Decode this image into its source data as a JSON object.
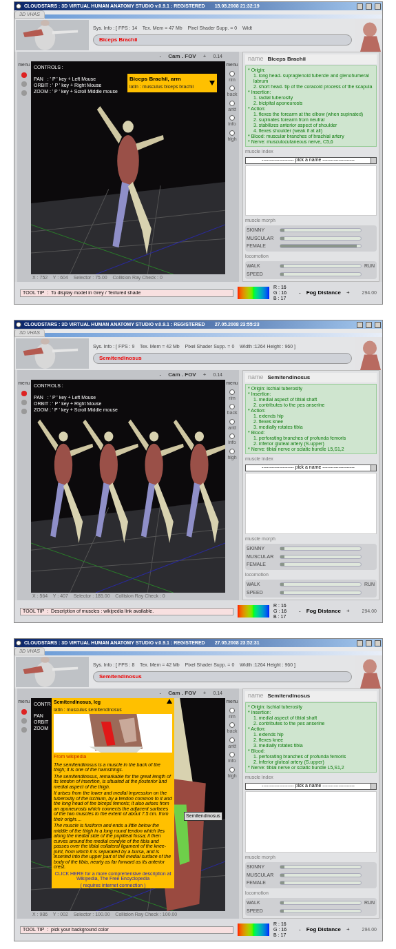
{
  "screens": [
    {
      "title": "CLOUDSTARS : 3D VIRTUAL HUMAN ANATOMY STUDIO v.0.9.1 : REGISTERED",
      "datetime": "15.05.2008 21:32:19",
      "tab": "3D VHAS",
      "sys_info": "Sys. Info : [ FPS : 14    Tex. Mem = 47 Mb    Pixel Shader Supp. = 0    Widt",
      "muscle": "Biceps Brachii",
      "camera": {
        "minus": "-",
        "label": "Cam . FOV",
        "plus": "+",
        "value": "0.14"
      },
      "left_menu_title": "menu",
      "right_menu_title": "menu",
      "right_menu": [
        "rim",
        "back",
        "antt",
        "info",
        "high"
      ],
      "controls": {
        "title": "CONTROLS :",
        "lines": [
          "PAN   : ' P ' key + Left Mouse",
          "ORBIT : ' P ' key + Right Mouse",
          "ZOOM : ' P ' key + Scroll Middle mouse"
        ]
      },
      "popup": {
        "title": "Biceps Brachii,  arm",
        "latin": "latin : musculus biceps brachii"
      },
      "name_label": "name",
      "name_value": "Biceps Brachii",
      "info": [
        {
          "text": "* Origin:",
          "children": [
            {
              "text": "1. long head- supraglenoid tubercle and glenohumeral labrum"
            },
            {
              "text": "2. short head- tip of the coracoid process of the scapula"
            }
          ]
        },
        {
          "text": "* Insertion:",
          "children": [
            {
              "text": "1. radial tuberosity"
            },
            {
              "text": "2. bicipital aponeurosis"
            }
          ]
        },
        {
          "text": "* Action:",
          "children": [
            {
              "text": "1. flexes the forearm at the elbow (when supinated)"
            },
            {
              "text": "2. supinates forearm from neutral"
            },
            {
              "text": "3. stabilizes anterior aspect of shoulder"
            },
            {
              "text": "4. flexes shoulder (weak if at all)"
            }
          ]
        },
        {
          "text": "* Blood: muscular branches of brachial artery"
        },
        {
          "text": "* Nerve: musculocutaneous nerve, C5,6"
        }
      ],
      "muscle_index": {
        "title": "muscle index",
        "value": "-------------------- pick a name --------------------"
      },
      "morph": {
        "title": "muscle morph",
        "sliders": [
          {
            "label": "SKINNY",
            "level": 0.05
          },
          {
            "label": "MUSCULAR",
            "level": 0.05
          },
          {
            "label": "FEMALE",
            "level": 0.95
          }
        ]
      },
      "locomotion": {
        "title": "locomotion",
        "sliders": [
          {
            "label": "WALK",
            "level": 0.04,
            "end": "RUN"
          },
          {
            "label": "SPEED",
            "level": 0.04
          }
        ]
      },
      "status": "X : 752    Y : 604    Selector : 75.00    Collision Ray Check : 0",
      "tooltip": {
        "label": "TOOL TIP  :",
        "text": "To display model in Grey / Textured shade"
      },
      "rgb": [
        "R : 16",
        "G : 16",
        "B : 17"
      ],
      "fog": {
        "minus": "-",
        "label": "Fog Distance",
        "plus": "+",
        "value": "294.00"
      }
    },
    {
      "title": "CLOUDSTARS : 3D VIRTUAL HUMAN ANATOMY STUDIO v.0.9.1 : REGISTERED",
      "datetime": "27.05.2008 23:55:23",
      "tab": "3D VHAS",
      "sys_info": "Sys. Info : [ FPS : 9    Tex. Mem = 42 Mb    Pixel Shader Supp. = 0    Width :1264 Height : 960 ]",
      "muscle": "Semitendinosus",
      "camera": {
        "minus": "-",
        "label": "Cam . FOV",
        "plus": "+",
        "value": "0.14"
      },
      "left_menu_title": "menu",
      "right_menu_title": "menu",
      "right_menu": [
        "rim",
        "back",
        "antt",
        "info",
        "high"
      ],
      "controls": {
        "title": "CONTROLS :",
        "lines": [
          "PAN   : ' P ' key + Left Mouse",
          "ORBIT : ' P ' key + Right Mouse",
          "ZOOM : ' P ' key + Scroll Middle mouse"
        ]
      },
      "name_label": "name",
      "name_value": "Semitendinosus",
      "info": [
        {
          "text": "* Origin: ischial tuberosity"
        },
        {
          "text": "* Insertion:",
          "children": [
            {
              "text": "1. medial aspect of tibial shaft"
            },
            {
              "text": "2. contributes to the pes anserine"
            }
          ]
        },
        {
          "text": "* Action:",
          "children": [
            {
              "text": "1. extends hip"
            },
            {
              "text": "2. flexes knee"
            },
            {
              "text": "3. medially rotates tibia"
            }
          ]
        },
        {
          "text": "* Blood:",
          "children": [
            {
              "text": "1. perforating branches of profunda femoris"
            },
            {
              "text": "2. inferior gluteal artery (S.upper)"
            }
          ]
        },
        {
          "text": "* Nerve: tibial nerve or sciatic bundle L5,S1,2"
        }
      ],
      "muscle_index": {
        "title": "muscle index",
        "value": "-------------------- pick a name --------------------"
      },
      "morph": {
        "title": "muscle morph",
        "sliders": [
          {
            "label": "SKINNY",
            "level": 0.05
          },
          {
            "label": "MUSCULAR",
            "level": 0.05
          },
          {
            "label": "FEMALE",
            "level": 0.05
          }
        ]
      },
      "locomotion": {
        "title": "locomotion",
        "sliders": [
          {
            "label": "WALK",
            "level": 0.04,
            "end": "RUN"
          },
          {
            "label": "SPEED",
            "level": 0.04
          }
        ]
      },
      "status": "X : 564    Y : 407    Selector : 185.00    Collision Ray Check : 0",
      "tooltip": {
        "label": "TOOL TIP  :",
        "text": "Description of muscles : wikipedia link available."
      },
      "rgb": [
        "R : 16",
        "G : 16",
        "B : 17"
      ],
      "fog": {
        "minus": "-",
        "label": "Fog Distance",
        "plus": "+",
        "value": "294.00"
      }
    },
    {
      "title": "CLOUDSTARS : 3D VIRTUAL HUMAN ANATOMY STUDIO v.0.9.1 : REGISTERED",
      "datetime": "27.05.2008 23:52:31",
      "tab": "3D VHAS",
      "sys_info": "Sys. Info : [ FPS : 8    Tex. Mem = 42 Mb    Pixel Shader Supp. = 0    Width :1264 Height : 960 ]",
      "muscle": "Semitendinosus",
      "camera": {
        "minus": "-",
        "label": "Cam . FOV",
        "plus": "+",
        "value": "0.14"
      },
      "left_menu_title": "menu",
      "right_menu_title": "menu",
      "right_menu": [
        "rim",
        "back",
        "antt",
        "info",
        "high"
      ],
      "controls": {
        "title": "CONTR",
        "lines": [
          "PAN",
          "ORBIT",
          "ZOOM"
        ]
      },
      "popup": {
        "title": "Semitendinosus, leg",
        "latin": "latin : musculus semitendinosus",
        "source": "From wikipedia",
        "paragraphs": [
          "The semitendinosus is a muscle in the back of the thigh; it is one of the hamstrings.",
          "The semitendinosus, remarkable for the great length of its tendon of insertion, is situated at the posterior and medial aspect of the thigh.",
          "It arises from the lower and medial impression on the tuberosity of the ischium, by a tendon common to it and the long head of the biceps femoris; it also arises from an aponeurosis which connects the adjacent surfaces of the two muscles to the extent of about 7.5 cm. from their origin....",
          "The muscle is fusiform and ends a little below the middle of the thigh in a long round tendon which lies along the medial side of the popliteal fossa; it then curves around the medial condyle of the tibia and passes over the tibial collateral ligament of the knee-joint, from which it is separated by a bursa, and is inserted into the upper part of the medial surface of the body of the tibia, nearly as far forward as its anterior crest."
        ],
        "link": "CLICK HERE for a more comprehensive description at Wikipedia, The Free Encyclopedia",
        "link_note": "( requires internet connection )"
      },
      "leg_label": "Semitendinosus",
      "name_label": "name",
      "name_value": "Semitendinosus",
      "info": [
        {
          "text": "* Origin: ischial tuberosity"
        },
        {
          "text": "* Insertion:",
          "children": [
            {
              "text": "1. medial aspect of tibial shaft"
            },
            {
              "text": "2. contributes to the pes anserine"
            }
          ]
        },
        {
          "text": "* Action:",
          "children": [
            {
              "text": "1. extends hip"
            },
            {
              "text": "2. flexes knee"
            },
            {
              "text": "3. medially rotates tibia"
            }
          ]
        },
        {
          "text": "* Blood:",
          "children": [
            {
              "text": "1. perforating branches of profunda femoris"
            },
            {
              "text": "2. inferior gluteal artery (S.upper)"
            }
          ]
        },
        {
          "text": "* Nerve: tibial nerve or sciatic bundle L5,S1,2"
        }
      ],
      "muscle_index": {
        "title": "muscle index",
        "value": "-------------------- pick a name --------------------"
      },
      "morph": {
        "title": "muscle morph",
        "sliders": [
          {
            "label": "SKINNY",
            "level": 0.05
          },
          {
            "label": "MUSCULAR",
            "level": 0.05
          },
          {
            "label": "FEMALE",
            "level": 0.05
          }
        ]
      },
      "locomotion": {
        "title": "locomotion",
        "sliders": [
          {
            "label": "WALK",
            "level": 0.04,
            "end": "RUN"
          },
          {
            "label": "SPEED",
            "level": 0.04
          }
        ]
      },
      "status": "X : 986    Y : 002    Selector : 100.00    Collision Ray Check : 100.00",
      "tooltip": {
        "label": "TOOL TIP  :",
        "text": "pick your background color"
      },
      "rgb": [
        "R : 16",
        "G : 16",
        "B : 17"
      ],
      "fog": {
        "minus": "-",
        "label": "Fog Distance",
        "plus": "+",
        "value": "294.00"
      }
    }
  ]
}
